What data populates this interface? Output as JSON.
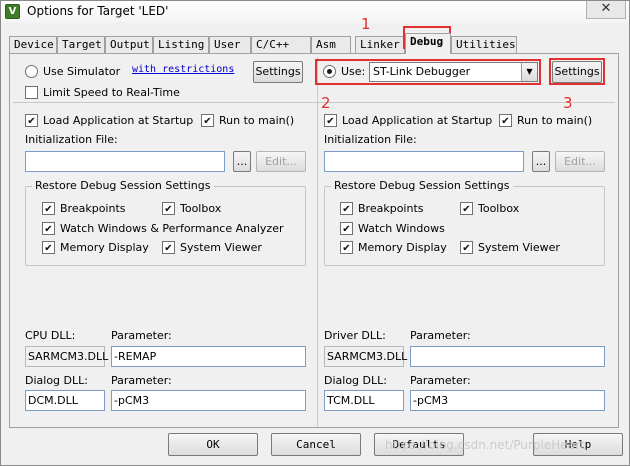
{
  "window": {
    "title": "Options for Target 'LED'",
    "icon": "V",
    "close": "✕"
  },
  "tabs": [
    "Device",
    "Target",
    "Output",
    "Listing",
    "User",
    "C/C++",
    "Asm",
    "Linker",
    "Debug",
    "Utilities"
  ],
  "left": {
    "use_simulator": "Use Simulator",
    "restrictions_link": "with restrictions",
    "settings": "Settings",
    "limit_speed": "Limit Speed to Real-Time",
    "load_app": "Load Application at Startup",
    "run_main": "Run to main()",
    "init_file_label": "Initialization File:",
    "browse": "...",
    "edit": "Edit...",
    "restore_title": "Restore Debug Session Settings",
    "breakpoints": "Breakpoints",
    "toolbox": "Toolbox",
    "watch_windows": "Watch Windows & Performance Analyzer",
    "memory_display": "Memory Display",
    "system_viewer": "System Viewer",
    "cpu_dll_label": "CPU DLL:",
    "cpu_param_label": "Parameter:",
    "cpu_dll": "SARMCM3.DLL",
    "cpu_param": "-REMAP",
    "dialog_dll_label": "Dialog DLL:",
    "dialog_param_label": "Parameter:",
    "dialog_dll": "DCM.DLL",
    "dialog_param": "-pCM3"
  },
  "right": {
    "use": "Use:",
    "debugger": "ST-Link Debugger",
    "settings": "Settings",
    "load_app": "Load Application at Startup",
    "run_main": "Run to main()",
    "init_file_label": "Initialization File:",
    "browse": "...",
    "edit": "Edit...",
    "restore_title": "Restore Debug Session Settings",
    "breakpoints": "Breakpoints",
    "toolbox": "Toolbox",
    "watch_windows": "Watch Windows",
    "memory_display": "Memory Display",
    "system_viewer": "System Viewer",
    "driver_dll_label": "Driver DLL:",
    "driver_param_label": "Parameter:",
    "driver_dll": "SARMCM3.DLL",
    "driver_param": "",
    "dialog_dll_label": "Dialog DLL:",
    "dialog_param_label": "Parameter:",
    "dialog_dll": "TCM.DLL",
    "dialog_param": "-pCM3"
  },
  "annotations": {
    "n1": "1",
    "n2": "2",
    "n3": "3"
  },
  "buttons": {
    "ok": "OK",
    "cancel": "Cancel",
    "defaults": "Defaults",
    "help": "Help"
  },
  "watermark": "https://blog.csdn.net/PurpleHeart",
  "colors": {
    "highlight": "#e0302f",
    "link": "#0000cc"
  }
}
